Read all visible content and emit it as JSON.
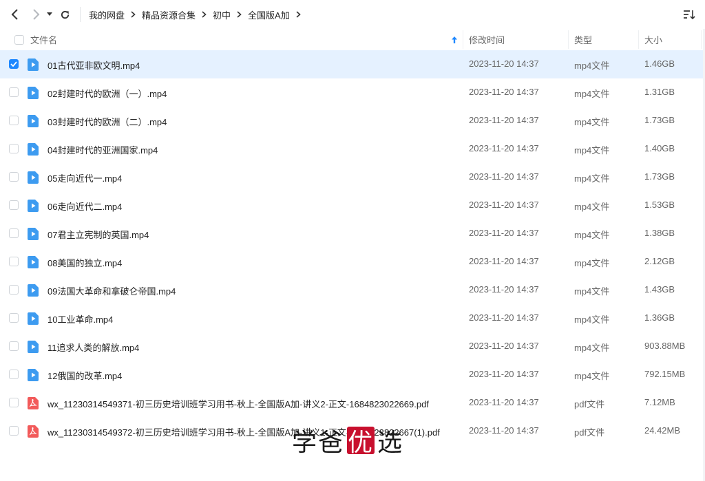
{
  "toolbar": {
    "back_icon": "chevron-left-icon",
    "forward_icon": "chevron-right-icon",
    "history_icon": "caret-down-icon",
    "refresh_icon": "refresh-icon",
    "sort_icon": "sort-list-icon"
  },
  "breadcrumb": [
    "我的网盘",
    "精品资源合集",
    "初中",
    "全国版A加"
  ],
  "columns": {
    "name": "文件名",
    "modified": "修改时间",
    "type": "类型",
    "size": "大小"
  },
  "files": [
    {
      "name": "01古代亚非欧文明.mp4",
      "date": "2023-11-20 14:37",
      "type": "mp4文件",
      "size": "1.46GB",
      "kind": "video",
      "selected": true
    },
    {
      "name": "02封建时代的欧洲（一）.mp4",
      "date": "2023-11-20 14:37",
      "type": "mp4文件",
      "size": "1.31GB",
      "kind": "video",
      "selected": false
    },
    {
      "name": "03封建时代的欧洲（二）.mp4",
      "date": "2023-11-20 14:37",
      "type": "mp4文件",
      "size": "1.73GB",
      "kind": "video",
      "selected": false
    },
    {
      "name": "04封建时代的亚洲国家.mp4",
      "date": "2023-11-20 14:37",
      "type": "mp4文件",
      "size": "1.40GB",
      "kind": "video",
      "selected": false
    },
    {
      "name": "05走向近代一.mp4",
      "date": "2023-11-20 14:37",
      "type": "mp4文件",
      "size": "1.73GB",
      "kind": "video",
      "selected": false
    },
    {
      "name": "06走向近代二.mp4",
      "date": "2023-11-20 14:37",
      "type": "mp4文件",
      "size": "1.53GB",
      "kind": "video",
      "selected": false
    },
    {
      "name": "07君主立宪制的英国.mp4",
      "date": "2023-11-20 14:37",
      "type": "mp4文件",
      "size": "1.38GB",
      "kind": "video",
      "selected": false
    },
    {
      "name": "08美国的独立.mp4",
      "date": "2023-11-20 14:37",
      "type": "mp4文件",
      "size": "2.12GB",
      "kind": "video",
      "selected": false
    },
    {
      "name": "09法国大革命和拿破仑帝国.mp4",
      "date": "2023-11-20 14:37",
      "type": "mp4文件",
      "size": "1.43GB",
      "kind": "video",
      "selected": false
    },
    {
      "name": "10工业革命.mp4",
      "date": "2023-11-20 14:37",
      "type": "mp4文件",
      "size": "1.36GB",
      "kind": "video",
      "selected": false
    },
    {
      "name": "11追求人类的解放.mp4",
      "date": "2023-11-20 14:37",
      "type": "mp4文件",
      "size": "903.88MB",
      "kind": "video",
      "selected": false
    },
    {
      "name": "12俄国的改革.mp4",
      "date": "2023-11-20 14:37",
      "type": "mp4文件",
      "size": "792.15MB",
      "kind": "video",
      "selected": false
    },
    {
      "name": "wx_11230314549371-初三历史培训班学习用书-秋上-全国版A加-讲义2-正文-1684823022669.pdf",
      "date": "2023-11-20 14:37",
      "type": "pdf文件",
      "size": "7.12MB",
      "kind": "pdf",
      "selected": false
    },
    {
      "name": "wx_11230314549372-初三历史培训班学习用书-秋上-全国版A加-讲义1-正文-1684823822667(1).pdf",
      "date": "2023-11-20 14:37",
      "type": "pdf文件",
      "size": "24.42MB",
      "kind": "pdf",
      "selected": false
    }
  ],
  "watermark": {
    "part1": "学爸",
    "part2": "优",
    "part3": "选"
  },
  "colors": {
    "accent": "#1e88ff",
    "selected_row": "#e5f1ff",
    "video_icon": "#3d9bf0",
    "pdf_icon": "#f25a5a",
    "watermark_red": "#c8102e"
  }
}
